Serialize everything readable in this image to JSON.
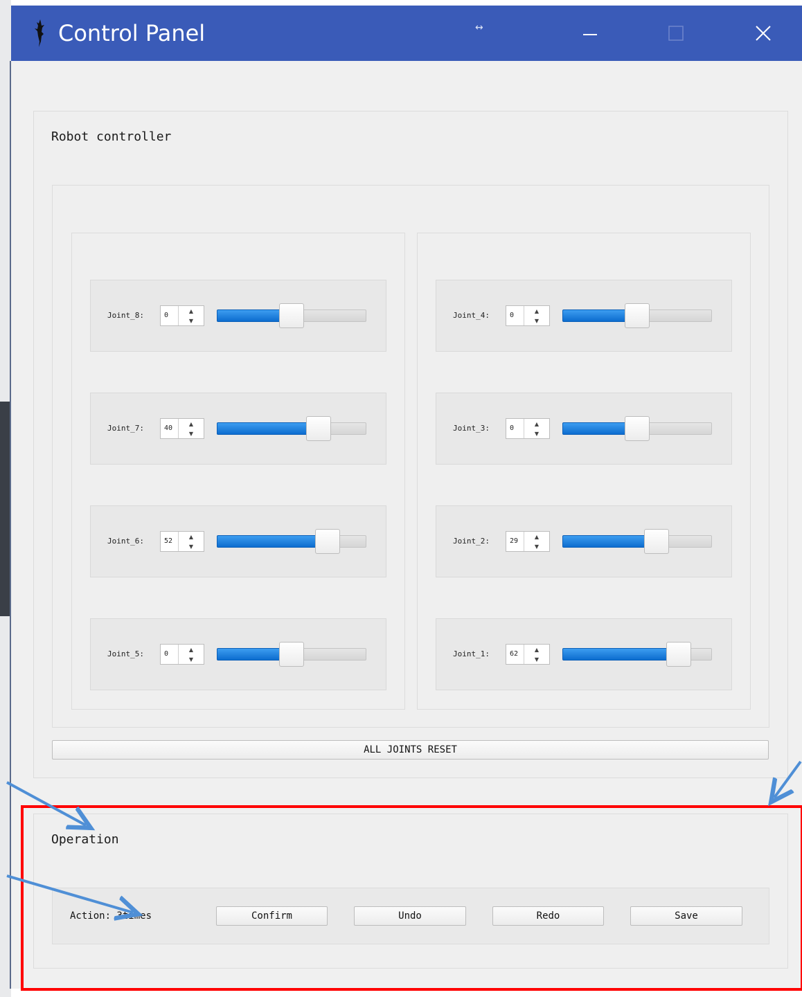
{
  "window": {
    "title": "Control Panel",
    "resize_glyph": "↔"
  },
  "robot_controller": {
    "title": "Robot controller",
    "left_column": [
      {
        "label": "Joint_8:",
        "value": "0",
        "level": 0.5
      },
      {
        "label": "Joint_7:",
        "value": "40",
        "level": 0.68
      },
      {
        "label": "Joint_6:",
        "value": "52",
        "level": 0.74
      },
      {
        "label": "Joint_5:",
        "value": "0",
        "level": 0.5
      }
    ],
    "right_column": [
      {
        "label": "Joint_4:",
        "value": "0",
        "level": 0.5
      },
      {
        "label": "Joint_3:",
        "value": "0",
        "level": 0.5
      },
      {
        "label": "Joint_2:",
        "value": "29",
        "level": 0.63
      },
      {
        "label": "Joint_1:",
        "value": "62",
        "level": 0.78
      }
    ],
    "reset_label": "ALL JOINTS RESET"
  },
  "operation": {
    "title": "Operation",
    "action_text": "Action: 3times",
    "buttons": {
      "confirm": "Confirm",
      "undo": "Undo",
      "redo": "Redo",
      "save": "Save"
    }
  },
  "colors": {
    "titlebar": "#3a5bb8",
    "accent": "#0c6ccf",
    "annotation": "#ff0000",
    "arrow": "#4f8fd6"
  }
}
